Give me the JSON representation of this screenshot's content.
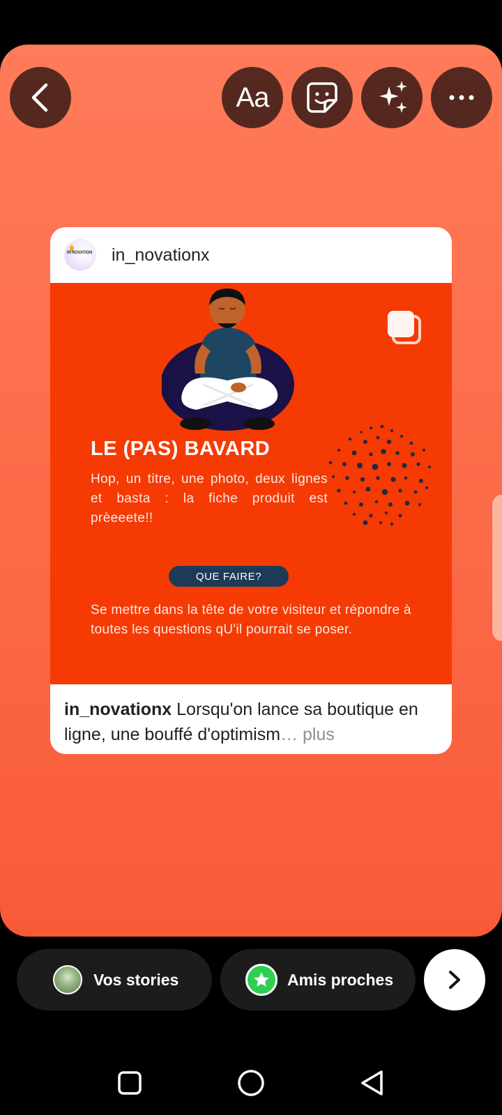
{
  "header": {
    "text_tool_label": "Aa",
    "icons": [
      "back-arrow-icon",
      "sticker-icon",
      "sparkles-icon",
      "more-dots-icon"
    ]
  },
  "post": {
    "username": "in_novationx",
    "avatar_logo_text": "IN NOVATION",
    "image": {
      "title": "LE (PAS) BAVARD",
      "body": "Hop, un titre, une photo, deux lignes et basta : la fiche produit est prèeeete!!",
      "pill_label": "QUE FAIRE?",
      "body2": "Se mettre dans la tête de votre visiteur et répondre à toutes les questions qU'il pourrait se poser."
    },
    "caption_user": "in_novationx",
    "caption_text": " Lorsqu'on lance sa boutique en ligne, une bouffé d'optimism",
    "caption_more": "… plus"
  },
  "share": {
    "stories_label": "Vos stories",
    "close_friends_label": "Amis proches"
  },
  "colors": {
    "background_top": "#ff7b5a",
    "background_bottom": "#f85a38",
    "post_image_bg": "#f53a04",
    "pill_bg": "#1d3b57",
    "close_friends_green": "#2fd052"
  }
}
